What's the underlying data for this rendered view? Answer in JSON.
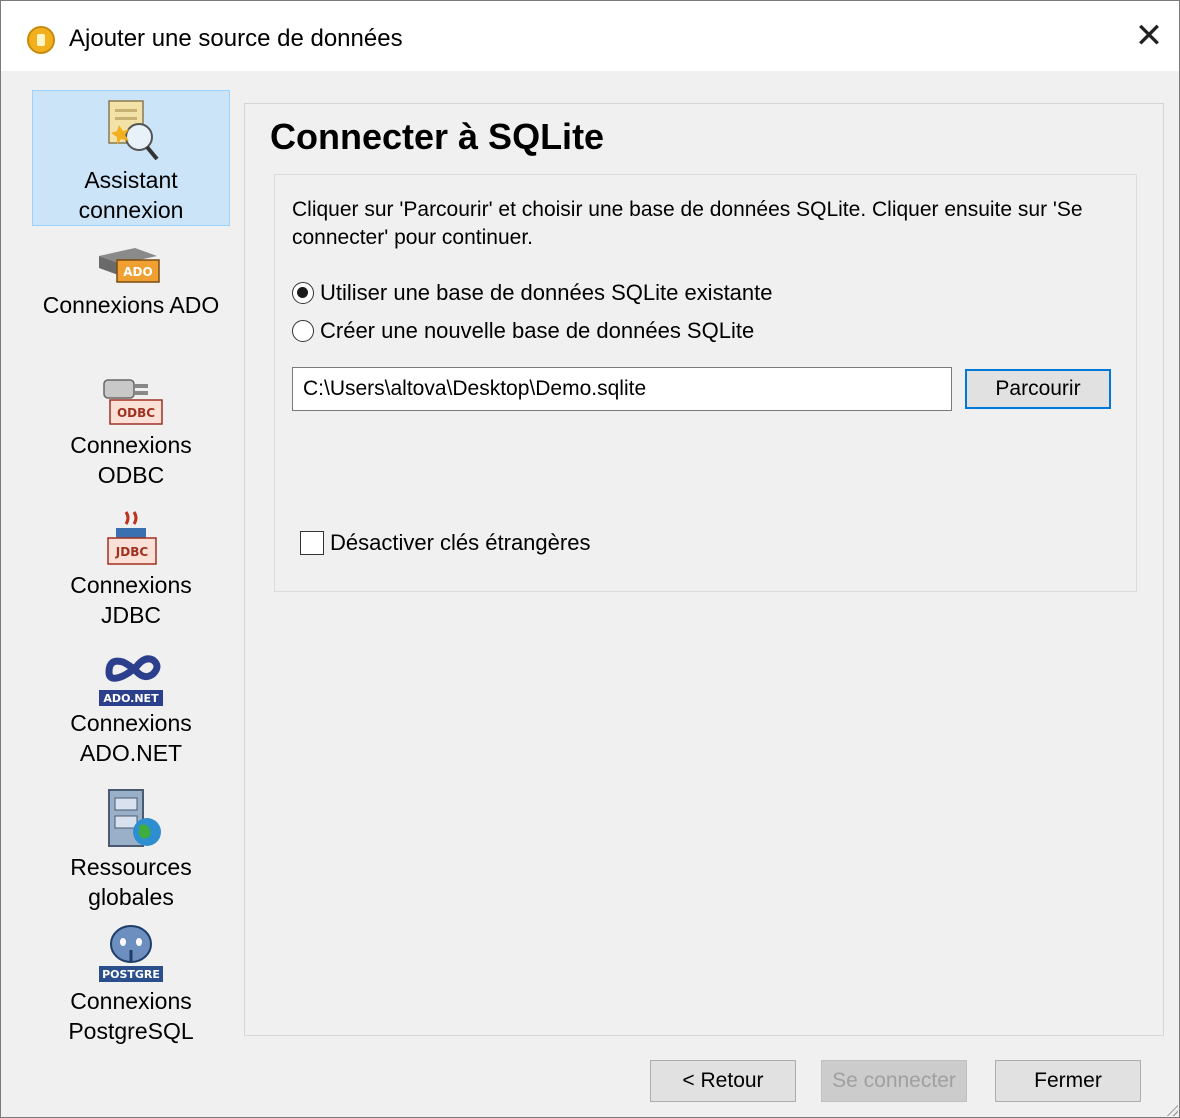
{
  "window": {
    "title": "Ajouter une source de données",
    "close_glyph": "✕"
  },
  "sidebar": {
    "items": [
      {
        "line1": "Assistant",
        "line2": "connexion",
        "icon": "connection-wizard-icon"
      },
      {
        "line1": "Connexions ADO",
        "line2": "",
        "icon": "ado-icon",
        "badge": "ADO"
      },
      {
        "line1": "Connexions",
        "line2": "ODBC",
        "icon": "odbc-icon",
        "badge": "ODBC"
      },
      {
        "line1": "Connexions",
        "line2": "JDBC",
        "icon": "jdbc-icon",
        "badge": "JDBC"
      },
      {
        "line1": "Connexions",
        "line2": "ADO.NET",
        "icon": "adonet-icon",
        "badge": "ADO.NET"
      },
      {
        "line1": "Ressources",
        "line2": "globales",
        "icon": "global-resources-icon"
      },
      {
        "line1": "Connexions",
        "line2": "PostgreSQL",
        "icon": "postgresql-icon",
        "badge": "POSTGRE"
      }
    ]
  },
  "main": {
    "heading": "Connecter à SQLite",
    "description": "Cliquer sur 'Parcourir' et choisir une base de données SQLite. Cliquer ensuite sur 'Se connecter' pour continuer.",
    "radio_existing": "Utiliser une base de données SQLite existante",
    "radio_new": "Créer une nouvelle base de données SQLite",
    "path_value": "C:\\Users\\altova\\Desktop\\Demo.sqlite",
    "browse_label": "Parcourir",
    "disable_fk_label": "Désactiver clés étrangères"
  },
  "footer": {
    "back_label": "< Retour",
    "connect_label": "Se connecter",
    "close_label": "Fermer"
  },
  "colors": {
    "selected_bg": "#cce4f7",
    "accent": "#0078d7"
  }
}
